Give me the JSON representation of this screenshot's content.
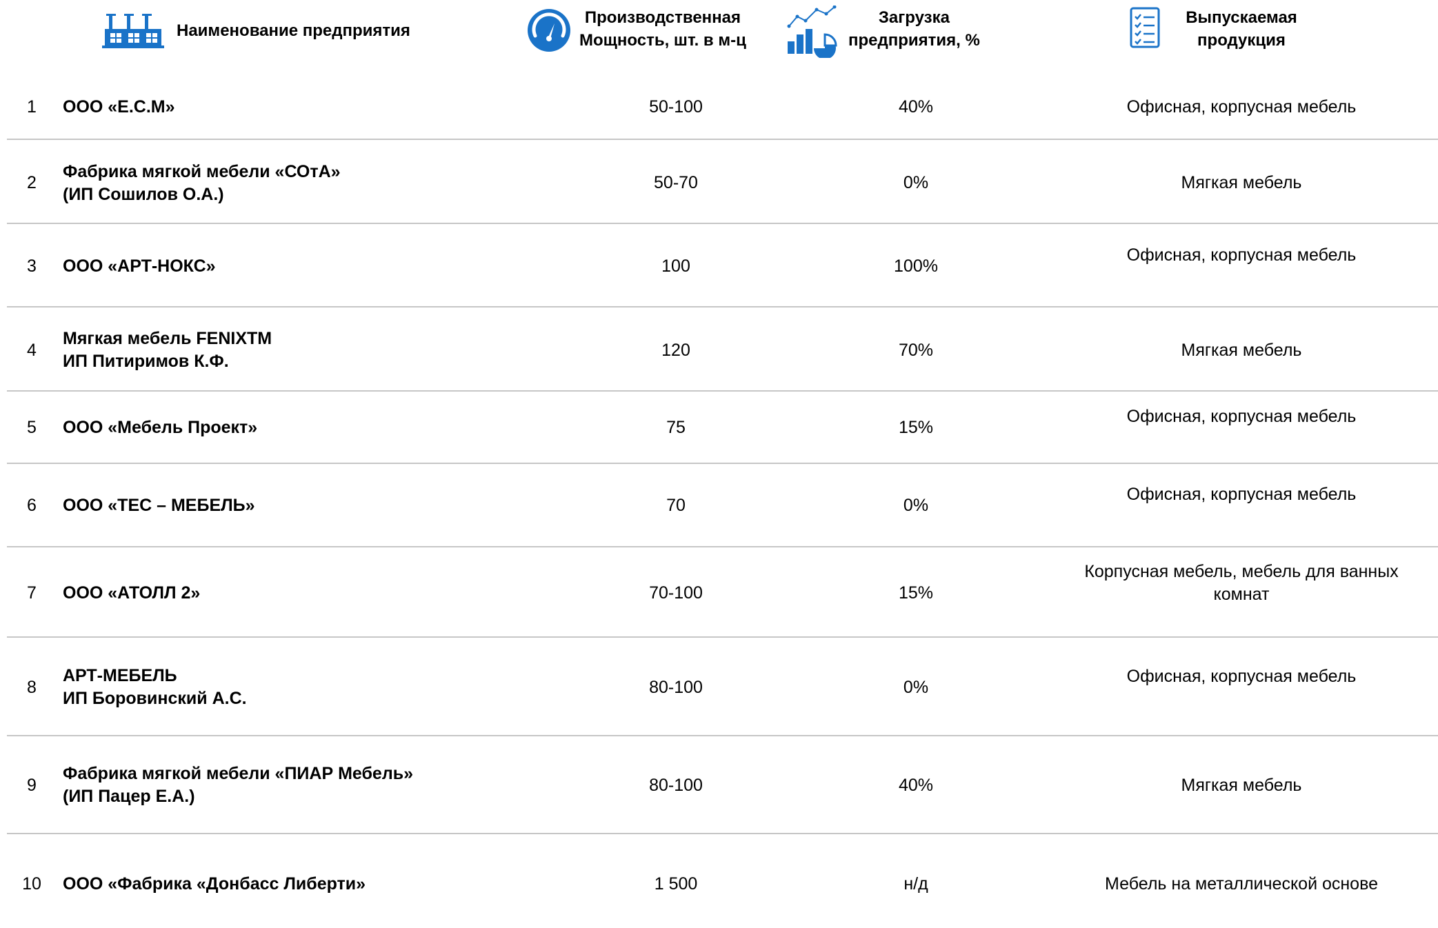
{
  "header": {
    "name_label": "Наименование предприятия",
    "capacity_label": "Производственная\nМощность, шт. в м-ц",
    "load_label": "Загрузка\nпредприятия, %",
    "products_label": "Выпускаемая\nпродукция",
    "icons": [
      "factory-icon",
      "gauge-icon",
      "analytics-chart-icon",
      "checklist-icon"
    ],
    "accent_color": "#1a73c8"
  },
  "rows": [
    {
      "num": "1",
      "name": "ООО «Е.С.М»",
      "capacity": "50-100",
      "load": "40%",
      "products": "Офисная, корпусная мебель"
    },
    {
      "num": "2",
      "name": "Фабрика мягкой мебели  «СОтА»\n(ИП Сошилов О.А.)",
      "capacity": "50-70",
      "load": "0%",
      "products": "Мягкая мебель"
    },
    {
      "num": "3",
      "name": "ООО «АРТ-НОКС»",
      "capacity": "100",
      "load": "100%",
      "products": "Офисная, корпусная мебель"
    },
    {
      "num": "4",
      "name": "Мягкая мебель FENIXTM\nИП Питиримов К.Ф.",
      "capacity": "120",
      "load": "70%",
      "products": "Мягкая мебель"
    },
    {
      "num": "5",
      "name": "ООО «Мебель Проект»",
      "capacity": "75",
      "load": "15%",
      "products": "Офисная, корпусная мебель"
    },
    {
      "num": "6",
      "name": "ООО «ТЕС – МЕБЕЛЬ»",
      "capacity": "70",
      "load": "0%",
      "products": "Офисная, корпусная мебель"
    },
    {
      "num": "7",
      "name": "ООО «АТОЛЛ 2»",
      "capacity": "70-100",
      "load": "15%",
      "products": "Корпусная мебель, мебель для ванных комнат"
    },
    {
      "num": "8",
      "name": "АРТ-МЕБЕЛЬ\nИП Боровинский А.С.",
      "capacity": "80-100",
      "load": "0%",
      "products": "Офисная, корпусная мебель"
    },
    {
      "num": "9",
      "name": "Фабрика мягкой мебели «ПИАР Мебель»\n(ИП Пацер Е.А.)",
      "capacity": "80-100",
      "load": "40%",
      "products": "Мягкая мебель"
    },
    {
      "num": "10",
      "name": "ООО «Фабрика «Донбасс Либерти»",
      "capacity": "1 500",
      "load": "н/д",
      "products": "Мебель на металлической основе"
    }
  ]
}
